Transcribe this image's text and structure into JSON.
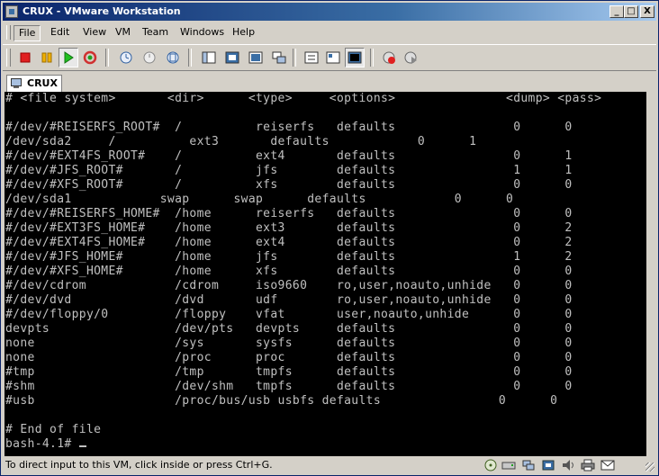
{
  "window": {
    "title": "CRUX - VMware Workstation",
    "controls": {
      "minimize": "_",
      "maximize": "□",
      "close": "X"
    }
  },
  "menu": {
    "items": [
      "File",
      "Edit",
      "View",
      "VM",
      "Team",
      "Windows",
      "Help"
    ]
  },
  "toolbar": {
    "buttons": [
      {
        "icon": "power-off-icon",
        "color": "#e02020"
      },
      {
        "icon": "suspend-icon",
        "color": "#e8a000"
      },
      {
        "icon": "power-on-icon",
        "color": "#20b020"
      },
      {
        "icon": "reset-icon",
        "color": "#d03030"
      },
      {
        "icon": "snapshot-icon"
      },
      {
        "icon": "revert-snapshot-icon"
      },
      {
        "icon": "snapshot-manager-icon"
      },
      {
        "icon": "show-sidebar-icon"
      },
      {
        "icon": "full-screen-icon"
      },
      {
        "icon": "quick-switch-icon"
      },
      {
        "icon": "unity-icon"
      },
      {
        "icon": "summary-view-icon"
      },
      {
        "icon": "appliance-view-icon"
      },
      {
        "icon": "console-view-icon",
        "pressed": true
      },
      {
        "icon": "record-icon"
      },
      {
        "icon": "replay-icon"
      }
    ]
  },
  "tab": {
    "label": "CRUX",
    "icon": "vm-tab-icon"
  },
  "console": {
    "lines": [
      "# <file system>       <dir>      <type>     <options>               <dump> <pass>",
      "",
      "#/dev/#REISERFS_ROOT#  /          reiserfs   defaults                0      0",
      "/dev/sda2     /          ext3       defaults            0      1",
      "#/dev/#EXT4FS_ROOT#    /          ext4       defaults                0      1",
      "#/dev/#JFS_ROOT#       /          jfs        defaults                1      1",
      "#/dev/#XFS_ROOT#       /          xfs        defaults                0      0",
      "/dev/sda1            swap      swap      defaults            0      0",
      "#/dev/#REISERFS_HOME#  /home      reiserfs   defaults                0      0",
      "#/dev/#EXT3FS_HOME#    /home      ext3       defaults                0      2",
      "#/dev/#EXT4FS_HOME#    /home      ext4       defaults                0      2",
      "#/dev/#JFS_HOME#       /home      jfs        defaults                1      2",
      "#/dev/#XFS_HOME#       /home      xfs        defaults                0      0",
      "#/dev/cdrom            /cdrom     iso9660    ro,user,noauto,unhide   0      0",
      "#/dev/dvd              /dvd       udf        ro,user,noauto,unhide   0      0",
      "#/dev/floppy/0         /floppy    vfat       user,noauto,unhide      0      0",
      "devpts                 /dev/pts   devpts     defaults                0      0",
      "none                   /sys       sysfs      defaults                0      0",
      "none                   /proc      proc       defaults                0      0",
      "#tmp                   /tmp       tmpfs      defaults                0      0",
      "#shm                   /dev/shm   tmpfs      defaults                0      0",
      "#usb                   /proc/bus/usb usbfs defaults                0      0",
      "",
      "# End of file"
    ],
    "prompt": "bash-4.1# "
  },
  "status": {
    "text": "To direct input to this VM, click inside or press Ctrl+G.",
    "icons": [
      "cd-drive-icon",
      "hard-disk-icon",
      "network-adapter-icon",
      "usb-device-icon",
      "sound-icon",
      "printer-icon",
      "message-icon"
    ]
  },
  "colors": {
    "title_gradient_start": "#0a246a",
    "title_gradient_end": "#a6caf0",
    "console_bg": "#000000",
    "console_fg": "#c0c0c0"
  }
}
